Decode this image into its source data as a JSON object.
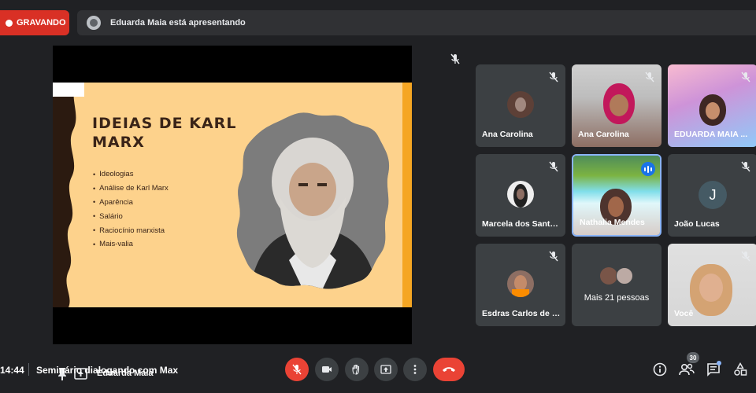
{
  "recording": {
    "label": "GRAVANDO",
    "color": "#d93025"
  },
  "presenting_banner": {
    "text": "Eduarda Maia está apresentando"
  },
  "stage": {
    "presenter_name": "Eduarda Maia",
    "slide": {
      "title": "IDEIAS DE KARL MARX",
      "bullets": [
        "Ideologias",
        "Análise de Karl Marx",
        "Aparência",
        "Salário",
        "Raciocínio marxista",
        "Mais-valia"
      ],
      "background": "#fdd28c",
      "accent": "#f5a623"
    }
  },
  "participants": [
    {
      "name": "Ana Carolina",
      "muted": true,
      "avatar": "photo-circle"
    },
    {
      "name": "Ana Carolina",
      "muted": true,
      "avatar": "video"
    },
    {
      "name": "EDUARDA MAIA ...",
      "muted": true,
      "avatar": "video"
    },
    {
      "name": "Marcela dos Santo...",
      "muted": true,
      "avatar": "photo-circle"
    },
    {
      "name": "Nathalia Mendes",
      "muted": false,
      "speaking": true,
      "avatar": "video"
    },
    {
      "name": "João Lucas",
      "muted": true,
      "avatar": "initial",
      "initial": "J",
      "avatar_color": "#455a64"
    },
    {
      "name": "Esdras Carlos de L...",
      "muted": true,
      "avatar": "photo-circle"
    },
    {
      "name": "Mais 21 pessoas",
      "muted": false,
      "avatar": "group"
    },
    {
      "name": "Você",
      "muted": true,
      "avatar": "video"
    }
  ],
  "bottom_bar": {
    "time": "14:44",
    "meeting_title": "Seminário dialogando com Max",
    "participant_count": "30",
    "controls": [
      "mic-off-icon",
      "camera-icon",
      "raise-hand-icon",
      "present-icon",
      "more-icon",
      "hangup-icon"
    ],
    "right_controls": [
      "info-icon",
      "people-icon",
      "chat-icon",
      "activities-icon"
    ]
  },
  "colors": {
    "background": "#202124",
    "tile": "#3c4043",
    "danger": "#ea4335",
    "speaking": "#1a73e8",
    "active_border": "#8ab4f8"
  }
}
